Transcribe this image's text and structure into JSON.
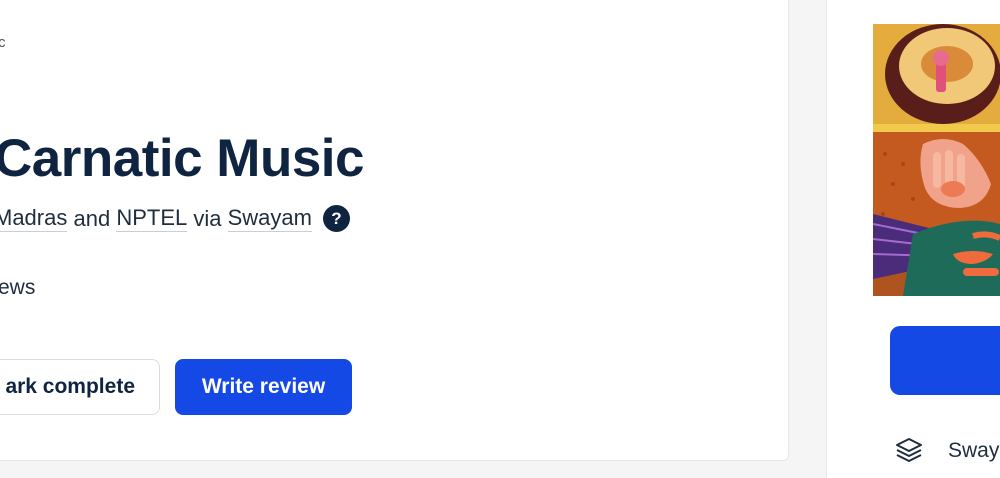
{
  "breadcrumb": {
    "tail": "c"
  },
  "course": {
    "title": "Carnatic Music",
    "provider_prefix": "Madras",
    "and_text": "and",
    "provider_nptel": "NPTEL",
    "via_text": "via",
    "platform": "Swayam",
    "help_glyph": "?",
    "reviews_tail": "ews"
  },
  "actions": {
    "mark_complete": "ark complete",
    "write_review": "Write review"
  },
  "sidebar": {
    "provider_label": "Sway"
  },
  "colors": {
    "primary": "#1549e6",
    "title": "#0f2440"
  }
}
